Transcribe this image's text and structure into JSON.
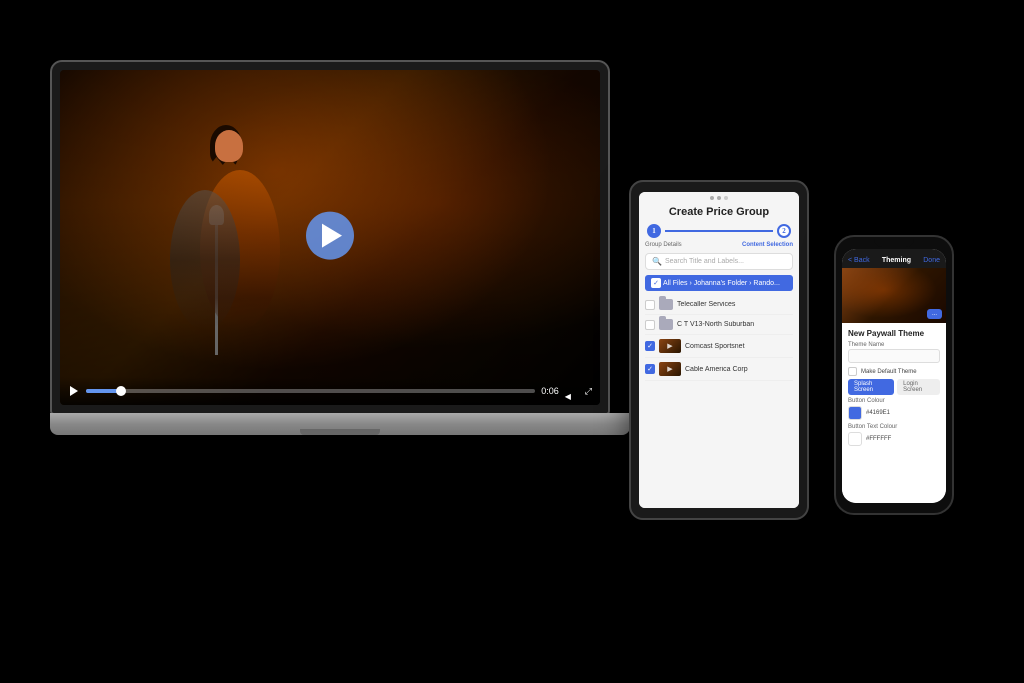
{
  "scene": {
    "bg_color": "#000000"
  },
  "laptop": {
    "video": {
      "play_button_label": "Play",
      "time_display": "0:06",
      "controls": {
        "play_label": "Play",
        "volume_label": "Volume",
        "fullscreen_label": "Fullscreen"
      }
    }
  },
  "tablet": {
    "dots": [
      "dot1",
      "dot2",
      "dot3"
    ],
    "title": "Create Price Group",
    "steps": {
      "step1_label": "Group Details",
      "step2_label": "Content Selection",
      "step1_number": "1",
      "step2_number": "2"
    },
    "search_placeholder": "Search Title and Labels...",
    "breadcrumb": "All Files › Johanna's Folder › Rando...",
    "files": [
      {
        "name": "Telecaller Services",
        "type": "folder",
        "checked": false
      },
      {
        "name": "C T V13-North Suburban",
        "type": "folder",
        "checked": false
      },
      {
        "name": "Comcast Sportsnet",
        "type": "video",
        "checked": true
      },
      {
        "name": "Cable America Corp",
        "type": "video",
        "checked": true
      }
    ]
  },
  "phone": {
    "header": {
      "title": "Theming",
      "back_label": "< Back",
      "done_label": "Done"
    },
    "section_title": "New Paywall Theme",
    "form": {
      "theme_name_label": "Theme Name",
      "theme_name_placeholder": "",
      "make_default_label": "Make Default Theme",
      "tabs": [
        "Splash Screen",
        "Login Screen"
      ],
      "active_tab": "Splash Screen",
      "button_colour_label": "Button Colour",
      "button_colour_value": "#4169E1",
      "button_text_colour_label": "Button Text Colour",
      "button_text_colour_value": "#FFFFFF"
    }
  }
}
